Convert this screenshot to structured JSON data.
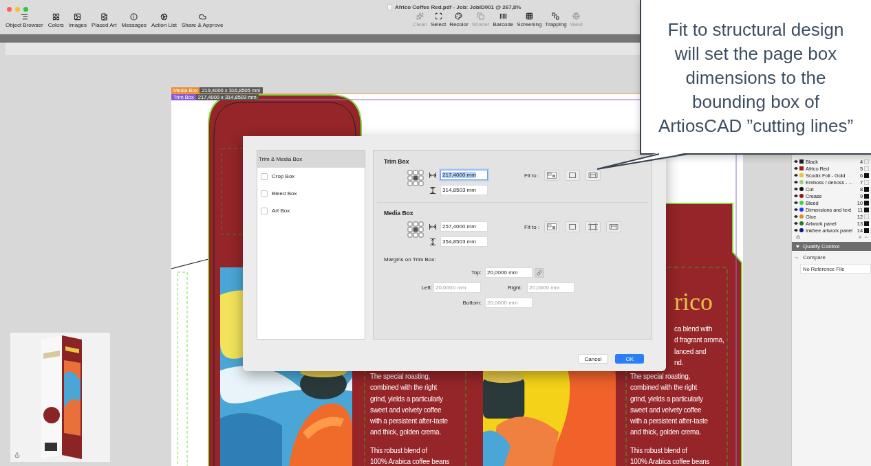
{
  "window": {
    "title": "Africo Coffee Red.pdf - Job: JobID001 @ 267,8%"
  },
  "toolbar": {
    "left_tools": [
      {
        "label": "Object Browser",
        "disabled": false
      },
      {
        "label": "Colors",
        "disabled": false
      },
      {
        "label": "Images",
        "disabled": false
      },
      {
        "label": "Placed Art",
        "disabled": false
      },
      {
        "label": "Messages",
        "disabled": false
      },
      {
        "label": "Action List",
        "disabled": false
      },
      {
        "label": "Share & Approve",
        "disabled": false
      }
    ],
    "right_tools": [
      {
        "label": "Clean",
        "disabled": true
      },
      {
        "label": "Select",
        "disabled": false
      },
      {
        "label": "Recolor",
        "disabled": false
      },
      {
        "label": "Shader",
        "disabled": true
      },
      {
        "label": "Barcode",
        "disabled": false
      },
      {
        "label": "Screening",
        "disabled": false
      },
      {
        "label": "Trapping",
        "disabled": false
      },
      {
        "label": "Weld",
        "disabled": true
      }
    ]
  },
  "canvas": {
    "box_labels": [
      {
        "kind": "media",
        "name": "Media Box",
        "dimensions": "219,4000 x 316,8505 mm"
      },
      {
        "kind": "trim",
        "name": "Trim Box",
        "dimensions": "217,4000 x 314,8503 mm"
      }
    ],
    "package": {
      "logo": "rico",
      "fragment": "ca blend with\nd fragrant aroma,\nlanced and\nnd.",
      "columns": [
        {
          "paragraphs": [
            "The special roasting,\ncombined with the right\ngrind, yields a particularly\nsweet and velvety coffee\nwith a persistent after-taste\nand thick, golden crema.",
            "This robust blend of\n100% Arabica coffee beans"
          ]
        },
        {
          "paragraphs": [
            "The special roasting,\ncombined with the right\ngrind, yields a particularly\nsweet and velvety coffee\nwith a persistent after-taste\nand thick, golden crema.",
            "This robust blend of\n100% Arabica coffee beans"
          ]
        }
      ]
    }
  },
  "dialog": {
    "sidebar": [
      {
        "kind": "header",
        "label": "Trim & Media Box",
        "selected": true
      },
      {
        "kind": "checkbox",
        "label": "Crop Box",
        "selected": false,
        "checked": false
      },
      {
        "kind": "checkbox",
        "label": "Bleed Box",
        "selected": false,
        "checked": false
      },
      {
        "kind": "checkbox",
        "label": "Art Box",
        "selected": false,
        "checked": false
      }
    ],
    "sections": [
      {
        "title": "Trim Box",
        "width": {
          "value": "217,4000 mm",
          "focused": true
        },
        "height": {
          "value": "314,8503 mm",
          "focused": false
        },
        "fit_label": "Fit to :",
        "fit_buttons": [
          {
            "kind": "artwork"
          },
          {
            "kind": "rectangle"
          },
          {
            "kind": "structural"
          }
        ]
      },
      {
        "title": "Media Box",
        "width": {
          "value": "257,4000 mm",
          "focused": false
        },
        "height": {
          "value": "354,8503 mm",
          "focused": false
        },
        "fit_label": "Fit to :",
        "fit_buttons": [
          {
            "kind": "artwork"
          },
          {
            "kind": "rectangle"
          },
          {
            "kind": "crop"
          },
          {
            "kind": "structural"
          }
        ]
      }
    ],
    "margins": {
      "label": "Margins on Trim Box:",
      "fields": [
        {
          "kind": "top",
          "label": "Top:",
          "value": "20,0000 mm",
          "disabled": false
        },
        {
          "kind": "left",
          "label": "Left:",
          "value": "20,0000 mm",
          "disabled": true
        },
        {
          "kind": "right",
          "label": "Right:",
          "value": "20,0000 mm",
          "disabled": true
        },
        {
          "kind": "bottom",
          "label": "Bottom:",
          "value": "20,0000 mm",
          "disabled": true
        }
      ]
    },
    "buttons": [
      {
        "label": "Cancel",
        "default": false
      },
      {
        "label": "OK",
        "default": true
      }
    ]
  },
  "layers": [
    {
      "kind": "ink",
      "name": "Black",
      "number": "4",
      "color": "#222222",
      "output": false
    },
    {
      "kind": "ink",
      "name": "Africo Red",
      "number": "5",
      "color": "#9a2020",
      "output": false
    },
    {
      "kind": "ink",
      "name": "Scodix Foil - Gold",
      "number": "6",
      "color": "#e8c840",
      "output": true
    },
    {
      "kind": "technical",
      "name": "Emboss / deboss - ...",
      "number": "7",
      "color": "#9ccf7a",
      "output": false
    },
    {
      "kind": "technical",
      "name": "Cut",
      "number": "8",
      "color": "#111111",
      "output": true
    },
    {
      "kind": "technical",
      "name": "Crease",
      "number": "9",
      "color": "#9a1515",
      "output": true
    },
    {
      "kind": "technical",
      "name": "Bleed",
      "number": "10",
      "color": "#3bd42f",
      "output": true
    },
    {
      "kind": "technical",
      "name": "Dimensions and text",
      "number": "11",
      "color": "#1a3de8",
      "output": true
    },
    {
      "kind": "technical",
      "name": "Glue",
      "number": "12",
      "color": "#e08a20",
      "output": false
    },
    {
      "kind": "technical",
      "name": "Artwork panel",
      "number": "13",
      "color": "#1f7a1f",
      "output": true
    },
    {
      "kind": "technical",
      "name": "Inkfree artwork panel",
      "number": "14",
      "color": "#0a1a8a",
      "output": true
    }
  ],
  "quality_control": {
    "title": "Quality Control",
    "compare": "Compare",
    "reference": "No Reference File"
  },
  "callout": {
    "text": "Fit to structural design\nwill set the page box\ndimensions to the\nbounding box of\nArtiosCAD ”cutting lines”"
  }
}
